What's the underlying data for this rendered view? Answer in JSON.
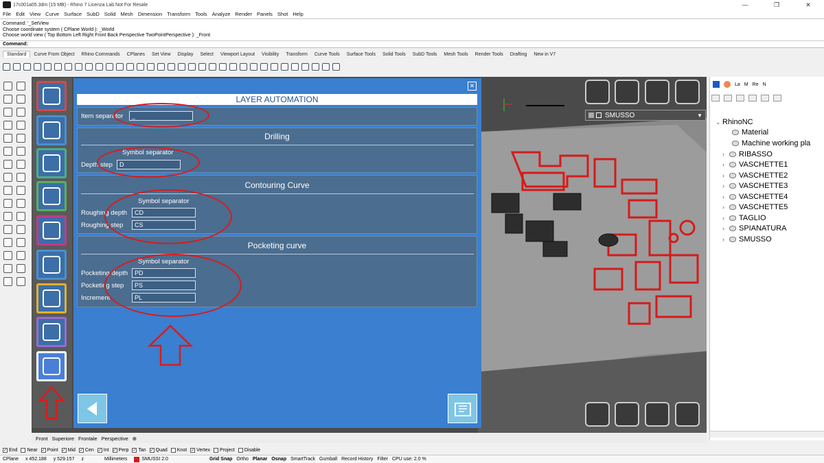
{
  "window": {
    "title": "17c001a05.3dm (15 MB) - Rhino 7 Licenza Lab Not For Resale",
    "minimize": "—",
    "maximize": "❐",
    "close": "✕"
  },
  "menu": [
    "File",
    "Edit",
    "View",
    "Curve",
    "Surface",
    "SubD",
    "Solid",
    "Mesh",
    "Dimension",
    "Transform",
    "Tools",
    "Analyze",
    "Render",
    "Panels",
    "Shot",
    "Help"
  ],
  "command_history": [
    "Command: '_SetView",
    "Choose coordinate system ( CPlane  World ): _World",
    "Choose world view ( Top  Bottom  Left  Right  Front  Back  Perspective  TwoPointPerspective ): _Front"
  ],
  "command_prompt": "Command:",
  "toolbar_tabs": [
    "Standard",
    "Curve From Object",
    "Rhino Commands",
    "CPlanes",
    "Set View",
    "Display",
    "Select",
    "Viewport Layout",
    "Visibility",
    "Transform",
    "Curve Tools",
    "Surface Tools",
    "Solid Tools",
    "SubD Tools",
    "Mesh Tools",
    "Render Tools",
    "Drafting",
    "New in V7"
  ],
  "layer_dropdown": "SMUSSO",
  "panel": {
    "title": "LAYER AUTOMATION",
    "close_glyph": "✕",
    "item_separator": {
      "label": "Item separator",
      "value": "_"
    },
    "drilling": {
      "heading": "Drilling",
      "symbol_separator": "Symbol separator",
      "depth_step_label": "Depth step",
      "depth_step_value": "D"
    },
    "contouring": {
      "heading": "Contouring Curve",
      "symbol_separator": "Symbol separator",
      "roughing_depth_label": "Roughing depth",
      "roughing_depth_value": "CD",
      "roughing_step_label": "Roughing step",
      "roughing_step_value": "CS"
    },
    "pocketing": {
      "heading": "Pocketing curve",
      "symbol_separator": "Symbol separator",
      "pocketing_depth_label": "Pocketing depth",
      "pocketing_depth_value": "PD",
      "pocketing_step_label": "Pocketing step",
      "pocketing_step_value": "PS",
      "increment_label": "Increment",
      "increment_value": "PL"
    }
  },
  "right_panel": {
    "tabs": [
      "La",
      "M",
      "Re",
      "N"
    ],
    "root": "RhinoNC",
    "items": [
      "Material",
      "Machine working pla",
      "RIBASSO",
      "VASCHETTE1",
      "VASCHETTE2",
      "VASCHETTE3",
      "VASCHETTE4",
      "VASCHETTE5",
      "TAGLIO",
      "SPIANATURA",
      "SMUSSO"
    ]
  },
  "viewport_tabs": [
    "Front",
    "Superiore",
    "Frontale",
    "Perspective",
    "⊕"
  ],
  "osnaps": [
    {
      "label": "End",
      "checked": true
    },
    {
      "label": "Near",
      "checked": false
    },
    {
      "label": "Point",
      "checked": true
    },
    {
      "label": "Mid",
      "checked": true
    },
    {
      "label": "Cen",
      "checked": true
    },
    {
      "label": "Int",
      "checked": true
    },
    {
      "label": "Perp",
      "checked": true
    },
    {
      "label": "Tan",
      "checked": true
    },
    {
      "label": "Quad",
      "checked": true
    },
    {
      "label": "Knot",
      "checked": false
    },
    {
      "label": "Vertex",
      "checked": true
    },
    {
      "label": "Project",
      "checked": false
    },
    {
      "label": "Disable",
      "checked": false
    }
  ],
  "status": {
    "cplane": "CPlane",
    "x": "x 452.188",
    "y": "y 529.157",
    "z": "z",
    "units": "Millimeters",
    "layer": "SMUSSI 2.0",
    "toggles": [
      "Grid Snap",
      "Ortho",
      "Planar",
      "Osnap",
      "SmartTrack",
      "Gumball",
      "Record History",
      "Filter"
    ],
    "cpu": "CPU use: 2.0 %"
  },
  "colors": {
    "panel_bg": "#3a7fd0",
    "section_bg": "#4b6d8f",
    "annotation_red": "#d91b1b"
  }
}
